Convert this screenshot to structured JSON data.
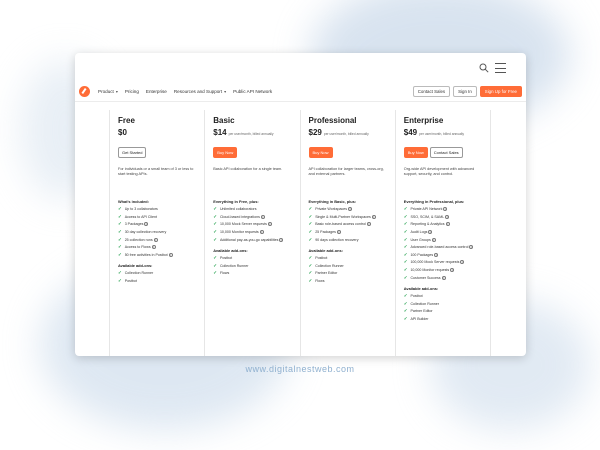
{
  "nav": {
    "items": [
      {
        "label": "Product",
        "has_caret": true
      },
      {
        "label": "Pricing",
        "has_caret": false
      },
      {
        "label": "Enterprise",
        "has_caret": false
      },
      {
        "label": "Resources and Support",
        "has_caret": true
      },
      {
        "label": "Public API Network",
        "has_caret": false
      }
    ],
    "contact_sales": "Contact Sales",
    "sign_in": "Sign In",
    "sign_up": "Sign Up for Free"
  },
  "plans": [
    {
      "name": "Free",
      "price": "$0",
      "per": "",
      "buttons": [
        {
          "label": "Get Started",
          "style": "outline"
        }
      ],
      "desc": "For individuals or a small team of 3 or less to start testing APIs.",
      "sections": [
        {
          "title": "What's included:",
          "features": [
            {
              "text": "Up to 3 collaborators",
              "info": false
            },
            {
              "text": "Access to API Client",
              "info": false
            },
            {
              "text": "3 Packages",
              "info": true
            },
            {
              "text": "30 day collection recovery",
              "info": false
            },
            {
              "text": "25 collection runs",
              "info": true
            },
            {
              "text": "Access to Flows",
              "info": true
            },
            {
              "text": "50 free activities in Postbot",
              "info": true
            }
          ]
        },
        {
          "title": "Available add-ons:",
          "features": [
            {
              "text": "Collection Runner",
              "info": false
            },
            {
              "text": "Postbot",
              "info": false
            }
          ]
        }
      ]
    },
    {
      "name": "Basic",
      "price": "$14",
      "per": "per user/month, billed annually",
      "buttons": [
        {
          "label": "Buy Now",
          "style": "orange"
        }
      ],
      "desc": "Basic API collaboration for a single team.",
      "sections": [
        {
          "title": "Everything in Free, plus:",
          "features": [
            {
              "text": "Unlimited collaborators",
              "info": false
            },
            {
              "text": "Cloud-based integrations",
              "info": true
            },
            {
              "text": "10,000 Mock Server requests",
              "info": true
            },
            {
              "text": "10,000 Monitor requests",
              "info": true
            },
            {
              "text": "Additional pay-as-you-go capabilities",
              "info": true
            }
          ]
        },
        {
          "title": "Available add-ons:",
          "features": [
            {
              "text": "Postbot",
              "info": false
            },
            {
              "text": "Collection Runner",
              "info": false
            },
            {
              "text": "Flows",
              "info": false
            }
          ]
        }
      ]
    },
    {
      "name": "Professional",
      "price": "$29",
      "per": "per user/month, billed annually",
      "buttons": [
        {
          "label": "Buy Now",
          "style": "orange"
        }
      ],
      "desc": "API collaboration for larger teams, cross-org, and external partners.",
      "sections": [
        {
          "title": "Everything in Basic, plus:",
          "features": [
            {
              "text": "Private Workspaces",
              "info": true
            },
            {
              "text": "Single & Multi-Partner Workspaces",
              "info": true
            },
            {
              "text": "Basic role-based access control",
              "info": true
            },
            {
              "text": "25 Packages",
              "info": true
            },
            {
              "text": "90 days collection recovery",
              "info": false
            }
          ]
        },
        {
          "title": "Available add-ons:",
          "features": [
            {
              "text": "Postbot",
              "info": false
            },
            {
              "text": "Collection Runner",
              "info": false
            },
            {
              "text": "Partner Editor",
              "info": false
            },
            {
              "text": "Flows",
              "info": false
            }
          ]
        }
      ]
    },
    {
      "name": "Enterprise",
      "price": "$49",
      "per": "per user/month, billed annually",
      "buttons": [
        {
          "label": "Buy Now",
          "style": "orange"
        },
        {
          "label": "Contact Sales",
          "style": "outline"
        }
      ],
      "desc": "Org-wide API development with advanced support, security, and control.",
      "sections": [
        {
          "title": "Everything in Professional, plus:",
          "features": [
            {
              "text": "Private API Network",
              "info": true
            },
            {
              "text": "SSO, SCIM, & SAML",
              "info": true
            },
            {
              "text": "Reporting & Analytics",
              "info": true
            },
            {
              "text": "Audit Logs",
              "info": true
            },
            {
              "text": "User Groups",
              "info": true
            },
            {
              "text": "Advanced role-based access control",
              "info": true
            },
            {
              "text": "100 Packages",
              "info": true
            },
            {
              "text": "100,000 Mock Server requests",
              "info": true
            },
            {
              "text": "10,000 Monitor requests",
              "info": true
            },
            {
              "text": "Customer Success",
              "info": true
            }
          ]
        },
        {
          "title": "Available add-ons:",
          "features": [
            {
              "text": "Postbot",
              "info": false
            },
            {
              "text": "Collection Runner",
              "info": false
            },
            {
              "text": "Partner Editor",
              "info": false
            },
            {
              "text": "API Builder",
              "info": false
            }
          ]
        }
      ]
    }
  ],
  "watermark": "www.digitalnestweb.com"
}
